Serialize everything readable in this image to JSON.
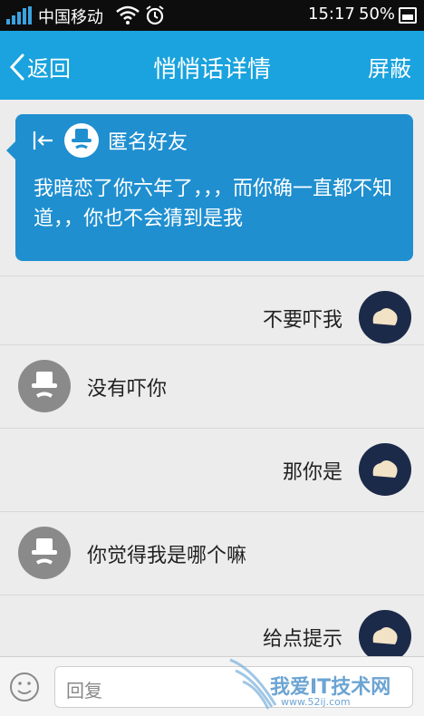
{
  "status_bar": {
    "carrier": "中国移动",
    "time": "15:17",
    "battery": "50%"
  },
  "header": {
    "back_label": "返回",
    "title": "悄悄话详情",
    "block_label": "屏蔽"
  },
  "card": {
    "sender": "匿名好友",
    "message": "我暗恋了你六年了，，，而你确一直都不知道，，你也不会猜到是我"
  },
  "messages": [
    {
      "side": "right",
      "text": "不要吓我"
    },
    {
      "side": "left",
      "text": "没有吓你"
    },
    {
      "side": "right",
      "text": "那你是"
    },
    {
      "side": "left",
      "text": "你觉得我是哪个嘛"
    },
    {
      "side": "right",
      "text": "给点提示"
    }
  ],
  "input": {
    "placeholder": "回复"
  },
  "watermark": {
    "text": "我爱IT技术网",
    "sub": "www.52ij.com"
  },
  "colors": {
    "header": "#1aa3de",
    "card": "#1f8fd0"
  }
}
